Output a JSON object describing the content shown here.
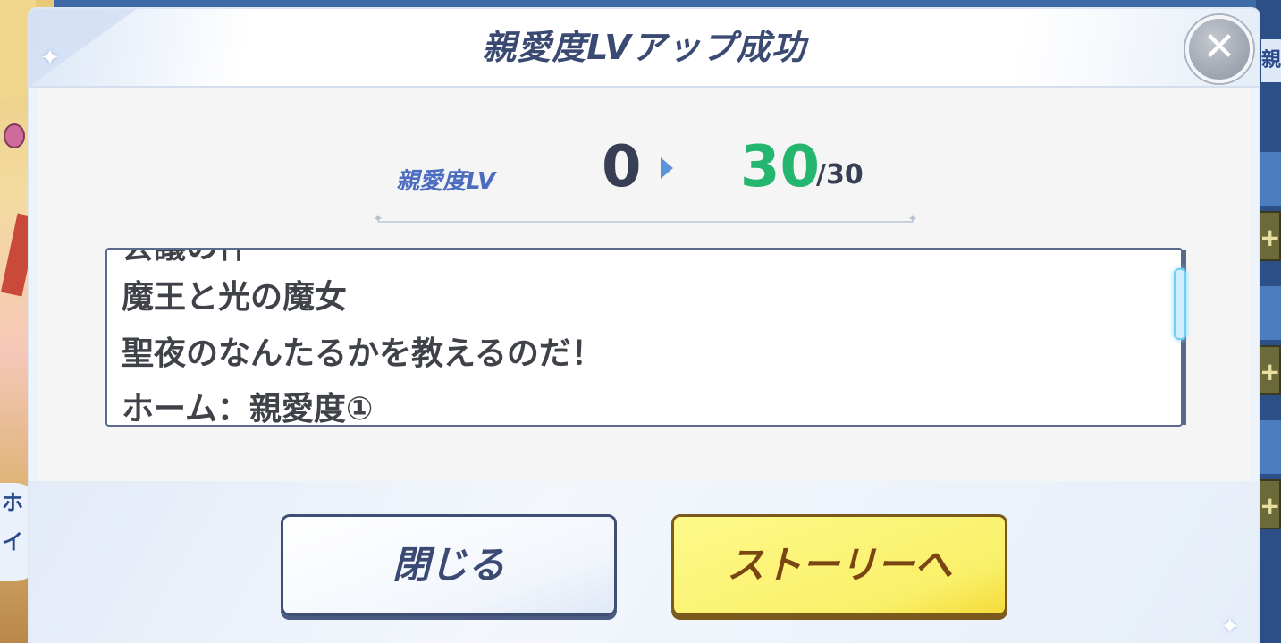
{
  "background": {
    "left_bubble_text": "ホ\nイ",
    "right_tab_label": "親",
    "plus_label": "+"
  },
  "modal": {
    "title": "親愛度LVアップ成功",
    "close_glyph": "✕"
  },
  "affection": {
    "label": "親愛度LV",
    "old_level": "0",
    "new_level": "30",
    "max_level": "/30"
  },
  "story_list": {
    "items": [
      "会議の件",
      "魔王と光の魔女",
      "聖夜のなんたるかを教えるのだ！",
      "ホーム：親愛度①"
    ]
  },
  "buttons": {
    "close_label": "閉じる",
    "story_label": "ストーリーへ"
  },
  "colors": {
    "title": "#3b4a72",
    "new_level": "#24b56e",
    "story_button": "#f9f06a",
    "scroll_thumb": "#6fd0f2"
  }
}
